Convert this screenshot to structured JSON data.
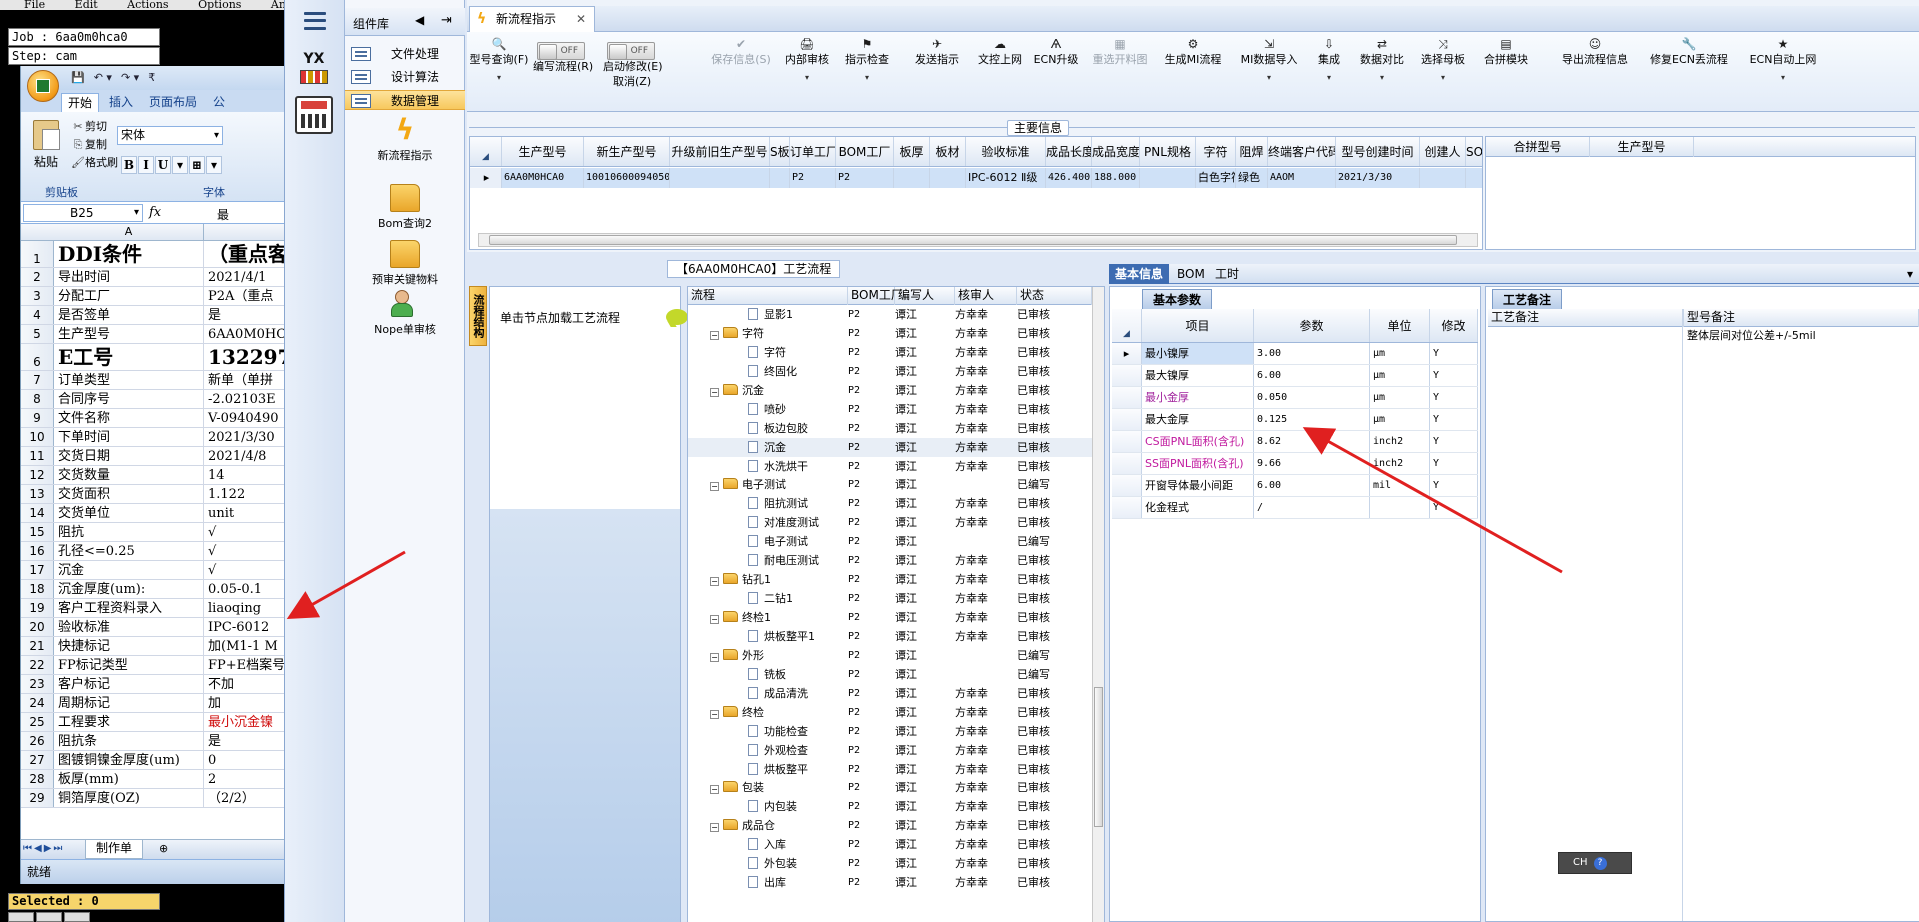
{
  "cam": {
    "menu": "File Edit Actions Options Analysis",
    "job": "Job : 6aa0m0hca0",
    "step": "Step: cam",
    "selected": "Selected : 0"
  },
  "excel": {
    "quick_access": [
      "💾",
      "↶ ▾",
      "↷ ▾",
      "₹"
    ],
    "tabs": [
      "开始",
      "插入",
      "页面布局",
      "公"
    ],
    "paste_label": "粘贴",
    "clip_items": [
      {
        "icon": "✂",
        "label": "剪切"
      },
      {
        "icon": "⎘",
        "label": "复制"
      },
      {
        "icon": "🖌",
        "label": "格式刷"
      }
    ],
    "group_clipboard": "剪贴板",
    "group_font": "字体",
    "font_name": "宋体",
    "font_buttons": [
      "B",
      "I",
      "U",
      "▾",
      "⊞",
      "▾"
    ],
    "name_box": "B25",
    "fx": "fx",
    "formula_value": "最",
    "column_a": "A",
    "rows": [
      {
        "n": "1",
        "a": "DDI条件",
        "b": "（重点客",
        "big": true
      },
      {
        "n": "2",
        "a": "导出时间",
        "b": "2021/4/1"
      },
      {
        "n": "3",
        "a": "分配工厂",
        "b": "P2A（重点"
      },
      {
        "n": "4",
        "a": "是否签单",
        "b": "是"
      },
      {
        "n": "5",
        "a": "生产型号",
        "b": "6AA0M0HCA"
      },
      {
        "n": "6",
        "a": "E工号",
        "b": "132297",
        "big": true
      },
      {
        "n": "7",
        "a": "订单类型",
        "b": "新单（单拼"
      },
      {
        "n": "8",
        "a": "合同序号",
        "b": "-2.02103E"
      },
      {
        "n": "9",
        "a": "文件名称",
        "b": "V-0940490"
      },
      {
        "n": "10",
        "a": "下单时间",
        "b": "2021/3/30"
      },
      {
        "n": "11",
        "a": "交货日期",
        "b": "2021/4/8"
      },
      {
        "n": "12",
        "a": "交货数量",
        "b": "14"
      },
      {
        "n": "13",
        "a": "交货面积",
        "b": "1.122"
      },
      {
        "n": "14",
        "a": "交货单位",
        "b": "unit"
      },
      {
        "n": "15",
        "a": "阻抗",
        "b": "√"
      },
      {
        "n": "16",
        "a": "孔径<=0.25",
        "b": "√"
      },
      {
        "n": "17",
        "a": "沉金",
        "b": "√"
      },
      {
        "n": "18",
        "a": "沉金厚度(um):",
        "b": "0.05-0.1"
      },
      {
        "n": "19",
        "a": "客户工程资料录入",
        "b": "liaoqing"
      },
      {
        "n": "20",
        "a": "验收标准",
        "b": "IPC-6012"
      },
      {
        "n": "21",
        "a": "快捷标记",
        "b": "加(M1-1 M"
      },
      {
        "n": "22",
        "a": "FP标记类型",
        "b": "FP+E档案号"
      },
      {
        "n": "23",
        "a": "客户标记",
        "b": "不加"
      },
      {
        "n": "24",
        "a": "周期标记",
        "b": "加"
      },
      {
        "n": "25",
        "a": "工程要求",
        "b": "最小沉金镍",
        "red": true
      },
      {
        "n": "26",
        "a": "阻抗条",
        "b": "是"
      },
      {
        "n": "27",
        "a": "图镀铜镍金厚度(um)",
        "b": "0"
      },
      {
        "n": "28",
        "a": "板厚(mm)",
        "b": "2"
      },
      {
        "n": "29",
        "a": "铜箔厚度(OZ)",
        "b": "（2/2）"
      }
    ],
    "sheet_nav": "⏮◀▶⏭",
    "sheet_tab": "制作单",
    "new_sheet": "⊕",
    "status": "就绪"
  },
  "app": {
    "component_panel": {
      "title": "组件库",
      "ctrl_collapse": "◀",
      "ctrl_pin": "⇥",
      "items": [
        "文件处理",
        "设计算法",
        "数据管理"
      ],
      "tiles": [
        "新流程指示",
        "Bom查询2",
        "预审关键物料",
        "Nope单审核"
      ]
    },
    "strip_yx": "YX",
    "doc_tab": {
      "label": "新流程指示",
      "close": "✕"
    },
    "toolbar": {
      "buttons": [
        {
          "icon": "🔍",
          "label": "型号查询(F)",
          "arrow": "▾",
          "disabled": false
        },
        {
          "icon": "✔",
          "label": "保存信息(S)",
          "arrow": "",
          "disabled": true
        },
        {
          "icon": "🖨",
          "label": "内部审核",
          "arrow": "▾",
          "disabled": false
        },
        {
          "icon": "⚑",
          "label": "指示检查",
          "arrow": "▾",
          "disabled": false
        },
        {
          "icon": "✈",
          "label": "发送指示",
          "arrow": "",
          "disabled": false
        },
        {
          "icon": "☁",
          "label": "文控上网",
          "arrow": "",
          "disabled": false
        },
        {
          "icon": "Ѧ",
          "label": "ECN升级",
          "arrow": "",
          "disabled": false
        },
        {
          "icon": "▦",
          "label": "重选开料图",
          "arrow": "",
          "disabled": true
        },
        {
          "icon": "⚙",
          "label": "生成MI流程",
          "arrow": "",
          "disabled": false
        },
        {
          "icon": "⇲",
          "label": "MI数据导入",
          "arrow": "▾",
          "disabled": false
        },
        {
          "icon": "⇩",
          "label": "集成",
          "arrow": "▾",
          "disabled": false
        },
        {
          "icon": "⇄",
          "label": "数据对比",
          "arrow": "▾",
          "disabled": false
        },
        {
          "icon": "⤨",
          "label": "选择母板",
          "arrow": "▾",
          "disabled": false
        },
        {
          "icon": "▤",
          "label": "合拼模块",
          "arrow": "",
          "disabled": false
        },
        {
          "icon": "☺",
          "label": "导出流程信息",
          "arrow": "",
          "disabled": false
        },
        {
          "icon": "🔧",
          "label": "修复ECN丢流程",
          "arrow": "",
          "disabled": false
        },
        {
          "icon": "★",
          "label": "ECN自动上网",
          "arrow": "▾",
          "disabled": false
        }
      ],
      "toggle1": {
        "state": "OFF",
        "label": "编写流程(R)"
      },
      "toggle2": {
        "state": "OFF",
        "label1": "启动修改(E)",
        "label2": "取消(Z)"
      }
    },
    "main_info": {
      "caption": "主要信息",
      "columns": [
        "生产型号",
        "新生产型号",
        "升级前旧生产型号",
        "S板",
        "订单工厂",
        "BOM工厂",
        "板厚",
        "板材",
        "验收标准",
        "成品长度",
        "成品宽度",
        "PNL规格",
        "字符",
        "阻焊",
        "终端客户代码",
        "型号创建时间",
        "创建人",
        "SO"
      ],
      "row": [
        "6AA0M0HCA0",
        "10010600094050",
        "",
        "",
        "P2",
        "P2",
        "",
        "",
        "IPC-6012 Ⅱ级",
        "426.400",
        "188.000",
        "",
        "白色字符",
        "绿色",
        "AAOM",
        "2021/3/30",
        "",
        ""
      ],
      "right_columns": [
        "合拼型号",
        "生产型号"
      ]
    },
    "flow": {
      "title": "【6AA0M0HCA0】工艺流程",
      "side_tab": "流程结构",
      "node_hint": "单击节点加载工艺流程",
      "columns": [
        "流程",
        "BOM工厂",
        "编写人",
        "核审人",
        "状态"
      ],
      "rows": [
        {
          "level": 2,
          "kind": "doc",
          "name": "显影1",
          "factory": "P2",
          "author": "谭江",
          "reviewer": "方幸幸",
          "status": "已审核"
        },
        {
          "level": 1,
          "kind": "folder",
          "name": "字符",
          "factory": "P2",
          "author": "谭江",
          "reviewer": "方幸幸",
          "status": "已审核"
        },
        {
          "level": 2,
          "kind": "doc",
          "name": "字符",
          "factory": "P2",
          "author": "谭江",
          "reviewer": "方幸幸",
          "status": "已审核"
        },
        {
          "level": 2,
          "kind": "doc",
          "name": "终固化",
          "factory": "P2",
          "author": "谭江",
          "reviewer": "方幸幸",
          "status": "已审核"
        },
        {
          "level": 1,
          "kind": "folder",
          "name": "沉金",
          "factory": "P2",
          "author": "谭江",
          "reviewer": "方幸幸",
          "status": "已审核"
        },
        {
          "level": 2,
          "kind": "doc",
          "name": "喷砂",
          "factory": "P2",
          "author": "谭江",
          "reviewer": "方幸幸",
          "status": "已审核"
        },
        {
          "level": 2,
          "kind": "doc",
          "name": "板边包胶",
          "factory": "P2",
          "author": "谭江",
          "reviewer": "方幸幸",
          "status": "已审核"
        },
        {
          "level": 2,
          "kind": "doc",
          "name": "沉金",
          "factory": "P2",
          "author": "谭江",
          "reviewer": "方幸幸",
          "status": "已审核",
          "sel": true
        },
        {
          "level": 2,
          "kind": "doc",
          "name": "水洗烘干",
          "factory": "P2",
          "author": "谭江",
          "reviewer": "方幸幸",
          "status": "已审核"
        },
        {
          "level": 1,
          "kind": "folder",
          "name": "电子测试",
          "factory": "P2",
          "author": "谭江",
          "reviewer": "",
          "status": "已编写"
        },
        {
          "level": 2,
          "kind": "doc",
          "name": "阻抗测试",
          "factory": "P2",
          "author": "谭江",
          "reviewer": "方幸幸",
          "status": "已审核"
        },
        {
          "level": 2,
          "kind": "doc",
          "name": "对准度测试",
          "factory": "P2",
          "author": "谭江",
          "reviewer": "方幸幸",
          "status": "已审核"
        },
        {
          "level": 2,
          "kind": "doc",
          "name": "电子测试",
          "factory": "P2",
          "author": "谭江",
          "reviewer": "",
          "status": "已编写"
        },
        {
          "level": 2,
          "kind": "doc",
          "name": "耐电压测试",
          "factory": "P2",
          "author": "谭江",
          "reviewer": "方幸幸",
          "status": "已审核"
        },
        {
          "level": 1,
          "kind": "folder",
          "name": "钻孔1",
          "factory": "P2",
          "author": "谭江",
          "reviewer": "方幸幸",
          "status": "已审核"
        },
        {
          "level": 2,
          "kind": "doc",
          "name": "二钻1",
          "factory": "P2",
          "author": "谭江",
          "reviewer": "方幸幸",
          "status": "已审核"
        },
        {
          "level": 1,
          "kind": "folder",
          "name": "终检1",
          "factory": "P2",
          "author": "谭江",
          "reviewer": "方幸幸",
          "status": "已审核"
        },
        {
          "level": 2,
          "kind": "doc",
          "name": "烘板整平1",
          "factory": "P2",
          "author": "谭江",
          "reviewer": "方幸幸",
          "status": "已审核"
        },
        {
          "level": 1,
          "kind": "folder",
          "name": "外形",
          "factory": "P2",
          "author": "谭江",
          "reviewer": "",
          "status": "已编写"
        },
        {
          "level": 2,
          "kind": "doc",
          "name": "铣板",
          "factory": "P2",
          "author": "谭江",
          "reviewer": "",
          "status": "已编写"
        },
        {
          "level": 2,
          "kind": "doc",
          "name": "成品清洗",
          "factory": "P2",
          "author": "谭江",
          "reviewer": "方幸幸",
          "status": "已审核"
        },
        {
          "level": 1,
          "kind": "folder",
          "name": "终检",
          "factory": "P2",
          "author": "谭江",
          "reviewer": "方幸幸",
          "status": "已审核"
        },
        {
          "level": 2,
          "kind": "doc",
          "name": "功能检查",
          "factory": "P2",
          "author": "谭江",
          "reviewer": "方幸幸",
          "status": "已审核"
        },
        {
          "level": 2,
          "kind": "doc",
          "name": "外观检查",
          "factory": "P2",
          "author": "谭江",
          "reviewer": "方幸幸",
          "status": "已审核"
        },
        {
          "level": 2,
          "kind": "doc",
          "name": "烘板整平",
          "factory": "P2",
          "author": "谭江",
          "reviewer": "方幸幸",
          "status": "已审核"
        },
        {
          "level": 1,
          "kind": "folder",
          "name": "包装",
          "factory": "P2",
          "author": "谭江",
          "reviewer": "方幸幸",
          "status": "已审核"
        },
        {
          "level": 2,
          "kind": "doc",
          "name": "内包装",
          "factory": "P2",
          "author": "谭江",
          "reviewer": "方幸幸",
          "status": "已审核"
        },
        {
          "level": 1,
          "kind": "folder",
          "name": "成品仓",
          "factory": "P2",
          "author": "谭江",
          "reviewer": "方幸幸",
          "status": "已审核"
        },
        {
          "level": 2,
          "kind": "doc",
          "name": "入库",
          "factory": "P2",
          "author": "谭江",
          "reviewer": "方幸幸",
          "status": "已审核"
        },
        {
          "level": 2,
          "kind": "doc",
          "name": "外包装",
          "factory": "P2",
          "author": "谭江",
          "reviewer": "方幸幸",
          "status": "已审核"
        },
        {
          "level": 2,
          "kind": "doc",
          "name": "出库",
          "factory": "P2",
          "author": "谭江",
          "reviewer": "方幸幸",
          "status": "已审核"
        }
      ]
    },
    "info": {
      "tabs": [
        "基本信息",
        "BOM",
        "工时"
      ],
      "params_caption": "基本参数",
      "param_columns": [
        "项目",
        "参数",
        "单位",
        "修改"
      ],
      "params": [
        {
          "name": "最小镍厚",
          "value": "3.00",
          "unit": "μm",
          "edit": "Y",
          "sel": true,
          "color": ""
        },
        {
          "name": "最大镍厚",
          "value": "6.00",
          "unit": "μm",
          "edit": "Y",
          "color": ""
        },
        {
          "name": "最小金厚",
          "value": "0.050",
          "unit": "μm",
          "edit": "Y",
          "color": "purple"
        },
        {
          "name": "最大金厚",
          "value": "0.125",
          "unit": "μm",
          "edit": "Y",
          "color": ""
        },
        {
          "name": "CS面PNL面积(含孔)",
          "value": "8.62",
          "unit": "inch2",
          "edit": "Y",
          "color": "magenta"
        },
        {
          "name": "SS面PNL面积(含孔)",
          "value": "9.66",
          "unit": "inch2",
          "edit": "Y",
          "color": "magenta"
        },
        {
          "name": "开窗导体最小间距",
          "value": "6.00",
          "unit": "mil",
          "edit": "Y",
          "color": ""
        },
        {
          "name": "化金程式",
          "value": "/",
          "unit": "",
          "edit": "Y",
          "color": ""
        }
      ],
      "remark_caption": "工艺备注",
      "remark_columns": [
        "工艺备注",
        "型号备注"
      ],
      "remark_row": {
        "process": "",
        "model": "整体层间对位公差+/-5mil"
      }
    },
    "ime": {
      "label": "CH",
      "help": "?"
    }
  },
  "colors": {
    "accent": "#3d6cb2",
    "annotation_red": "#e02020",
    "excel_red": "#d01010"
  }
}
